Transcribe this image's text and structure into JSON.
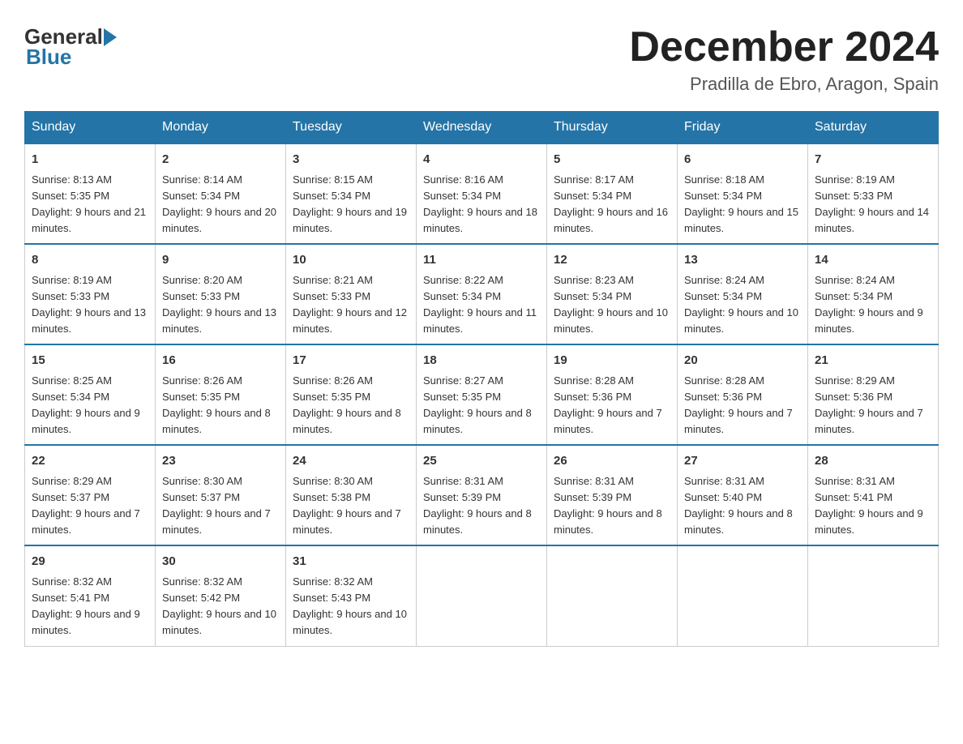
{
  "header": {
    "logo_text_general": "General",
    "logo_text_blue": "Blue",
    "month_title": "December 2024",
    "location": "Pradilla de Ebro, Aragon, Spain"
  },
  "weekdays": [
    "Sunday",
    "Monday",
    "Tuesday",
    "Wednesday",
    "Thursday",
    "Friday",
    "Saturday"
  ],
  "weeks": [
    [
      {
        "day": "1",
        "sunrise": "8:13 AM",
        "sunset": "5:35 PM",
        "daylight": "9 hours and 21 minutes."
      },
      {
        "day": "2",
        "sunrise": "8:14 AM",
        "sunset": "5:34 PM",
        "daylight": "9 hours and 20 minutes."
      },
      {
        "day": "3",
        "sunrise": "8:15 AM",
        "sunset": "5:34 PM",
        "daylight": "9 hours and 19 minutes."
      },
      {
        "day": "4",
        "sunrise": "8:16 AM",
        "sunset": "5:34 PM",
        "daylight": "9 hours and 18 minutes."
      },
      {
        "day": "5",
        "sunrise": "8:17 AM",
        "sunset": "5:34 PM",
        "daylight": "9 hours and 16 minutes."
      },
      {
        "day": "6",
        "sunrise": "8:18 AM",
        "sunset": "5:34 PM",
        "daylight": "9 hours and 15 minutes."
      },
      {
        "day": "7",
        "sunrise": "8:19 AM",
        "sunset": "5:33 PM",
        "daylight": "9 hours and 14 minutes."
      }
    ],
    [
      {
        "day": "8",
        "sunrise": "8:19 AM",
        "sunset": "5:33 PM",
        "daylight": "9 hours and 13 minutes."
      },
      {
        "day": "9",
        "sunrise": "8:20 AM",
        "sunset": "5:33 PM",
        "daylight": "9 hours and 13 minutes."
      },
      {
        "day": "10",
        "sunrise": "8:21 AM",
        "sunset": "5:33 PM",
        "daylight": "9 hours and 12 minutes."
      },
      {
        "day": "11",
        "sunrise": "8:22 AM",
        "sunset": "5:34 PM",
        "daylight": "9 hours and 11 minutes."
      },
      {
        "day": "12",
        "sunrise": "8:23 AM",
        "sunset": "5:34 PM",
        "daylight": "9 hours and 10 minutes."
      },
      {
        "day": "13",
        "sunrise": "8:24 AM",
        "sunset": "5:34 PM",
        "daylight": "9 hours and 10 minutes."
      },
      {
        "day": "14",
        "sunrise": "8:24 AM",
        "sunset": "5:34 PM",
        "daylight": "9 hours and 9 minutes."
      }
    ],
    [
      {
        "day": "15",
        "sunrise": "8:25 AM",
        "sunset": "5:34 PM",
        "daylight": "9 hours and 9 minutes."
      },
      {
        "day": "16",
        "sunrise": "8:26 AM",
        "sunset": "5:35 PM",
        "daylight": "9 hours and 8 minutes."
      },
      {
        "day": "17",
        "sunrise": "8:26 AM",
        "sunset": "5:35 PM",
        "daylight": "9 hours and 8 minutes."
      },
      {
        "day": "18",
        "sunrise": "8:27 AM",
        "sunset": "5:35 PM",
        "daylight": "9 hours and 8 minutes."
      },
      {
        "day": "19",
        "sunrise": "8:28 AM",
        "sunset": "5:36 PM",
        "daylight": "9 hours and 7 minutes."
      },
      {
        "day": "20",
        "sunrise": "8:28 AM",
        "sunset": "5:36 PM",
        "daylight": "9 hours and 7 minutes."
      },
      {
        "day": "21",
        "sunrise": "8:29 AM",
        "sunset": "5:36 PM",
        "daylight": "9 hours and 7 minutes."
      }
    ],
    [
      {
        "day": "22",
        "sunrise": "8:29 AM",
        "sunset": "5:37 PM",
        "daylight": "9 hours and 7 minutes."
      },
      {
        "day": "23",
        "sunrise": "8:30 AM",
        "sunset": "5:37 PM",
        "daylight": "9 hours and 7 minutes."
      },
      {
        "day": "24",
        "sunrise": "8:30 AM",
        "sunset": "5:38 PM",
        "daylight": "9 hours and 7 minutes."
      },
      {
        "day": "25",
        "sunrise": "8:31 AM",
        "sunset": "5:39 PM",
        "daylight": "9 hours and 8 minutes."
      },
      {
        "day": "26",
        "sunrise": "8:31 AM",
        "sunset": "5:39 PM",
        "daylight": "9 hours and 8 minutes."
      },
      {
        "day": "27",
        "sunrise": "8:31 AM",
        "sunset": "5:40 PM",
        "daylight": "9 hours and 8 minutes."
      },
      {
        "day": "28",
        "sunrise": "8:31 AM",
        "sunset": "5:41 PM",
        "daylight": "9 hours and 9 minutes."
      }
    ],
    [
      {
        "day": "29",
        "sunrise": "8:32 AM",
        "sunset": "5:41 PM",
        "daylight": "9 hours and 9 minutes."
      },
      {
        "day": "30",
        "sunrise": "8:32 AM",
        "sunset": "5:42 PM",
        "daylight": "9 hours and 10 minutes."
      },
      {
        "day": "31",
        "sunrise": "8:32 AM",
        "sunset": "5:43 PM",
        "daylight": "9 hours and 10 minutes."
      },
      null,
      null,
      null,
      null
    ]
  ]
}
